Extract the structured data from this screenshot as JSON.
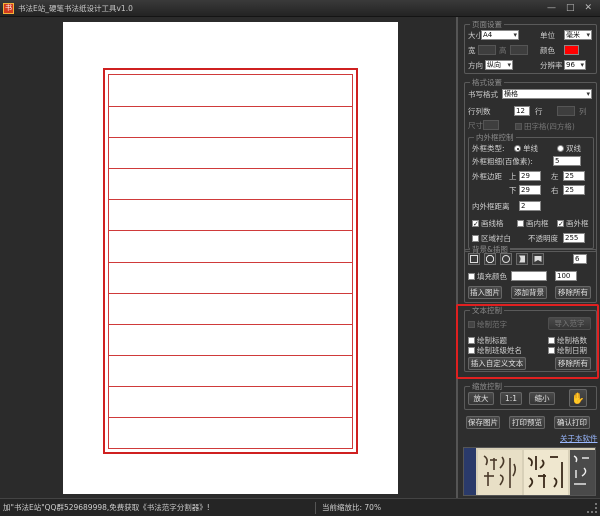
{
  "window": {
    "title": "书法E站_硬笔书法纸设计工具v1.0",
    "icon_text": "书",
    "min": "—",
    "max": "□",
    "close": "✕"
  },
  "paper_settings": {
    "title": "页面设置",
    "size_label": "大小",
    "size_value": "A4",
    "unit_label": "单位",
    "unit_value": "毫米",
    "width_label": "宽",
    "height_label": "高",
    "color_label": "颜色",
    "color_value": "#ff0000",
    "orientation_label": "方向",
    "orientation_value": "纵向",
    "dpi_label": "分辨率",
    "dpi_value": "96"
  },
  "style_settings": {
    "title": "格式设置",
    "writing_format_label": "书写格式",
    "writing_format_value": "横格",
    "rows_label": "行列数",
    "rows_value": "12",
    "row_label": "行",
    "col_label": "列",
    "size_label": "尺寸",
    "tianzige_label": "田字格(四方格)",
    "frame": {
      "title": "内外框控制",
      "outer_type_label": "外框类型:",
      "single_label": "单线",
      "double_label": "双线",
      "thickness_label": "外框粗细(百像素):",
      "thickness_value": "5",
      "margin_label": "外框边距",
      "top_label": "上",
      "top_value": "29",
      "left_label": "左",
      "left_value": "25",
      "bottom_label": "下",
      "bottom_value": "29",
      "right_label": "右",
      "right_value": "25",
      "gap_label": "内外框距离",
      "gap_value": "2",
      "draw_grid_label": "画线格",
      "draw_inner_label": "画内框",
      "draw_outer_label": "画外框",
      "area_white_label": "区域衬白",
      "opacity_label": "不透明度",
      "opacity_value": "255"
    }
  },
  "background": {
    "title": "背景&插图",
    "count_value": "6",
    "fill_color_label": "填充颜色",
    "fill_value": "100",
    "insert_image": "插入图片",
    "add_background": "添加背景",
    "remove_all": "移除所有"
  },
  "text_control": {
    "title": "文本控制",
    "draw_char_label": "绘制范字",
    "import_char": "导入范字",
    "draw_title": "绘制标题",
    "draw_score": "绘制格数",
    "draw_class_name": "绘制班级姓名",
    "draw_date": "绘制日期",
    "insert_custom": "插入自定义文本",
    "remove_all": "移除所有"
  },
  "zoom_control": {
    "title": "缩放控制",
    "zoom_in": "放大",
    "zoom_reset": "1:1",
    "zoom_out": "缩小"
  },
  "actions": {
    "save_image": "保存图片",
    "print_preview": "打印预览",
    "confirm_print": "确认打印",
    "about": "关于本软件"
  },
  "paper": {
    "rows": 12
  },
  "status": {
    "left": "加\"书法E站\"QQ群529689998,免费获取《书法范字分割器》!",
    "zoom": "当前缩放比: 70%"
  }
}
